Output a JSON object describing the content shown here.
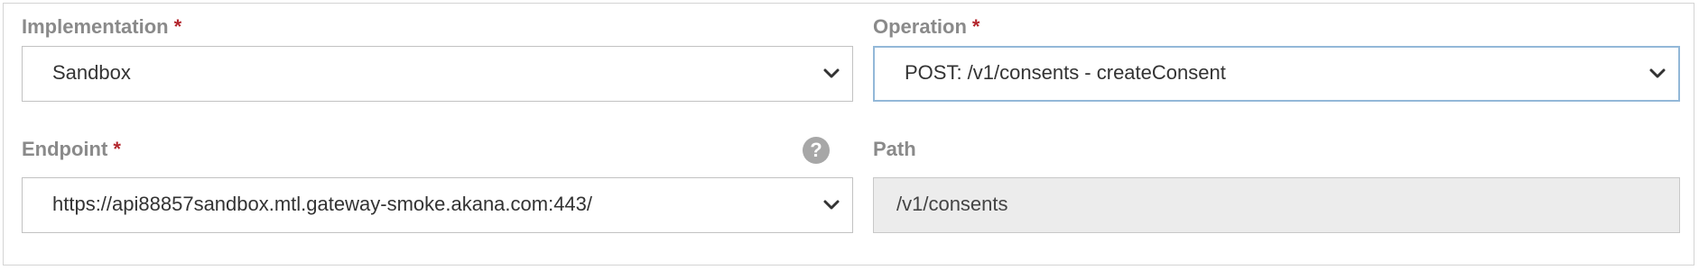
{
  "implementation": {
    "label": "Implementation",
    "required_marker": "*",
    "value": "Sandbox",
    "icon": "chevron-down-icon"
  },
  "operation": {
    "label": "Operation",
    "required_marker": "*",
    "value": "POST: /v1/consents - createConsent",
    "icon": "chevron-down-icon"
  },
  "endpoint": {
    "label": "Endpoint",
    "required_marker": "*",
    "value": "https://api88857sandbox.mtl.gateway-smoke.akana.com:443/",
    "help_icon": "?",
    "icon": "chevron-down-icon"
  },
  "path": {
    "label": "Path",
    "value": "/v1/consents"
  },
  "colors": {
    "label": "#8a8a8a",
    "required": "#b3262d",
    "focus_border": "#93b8d8",
    "readonly_bg": "#ececec"
  }
}
